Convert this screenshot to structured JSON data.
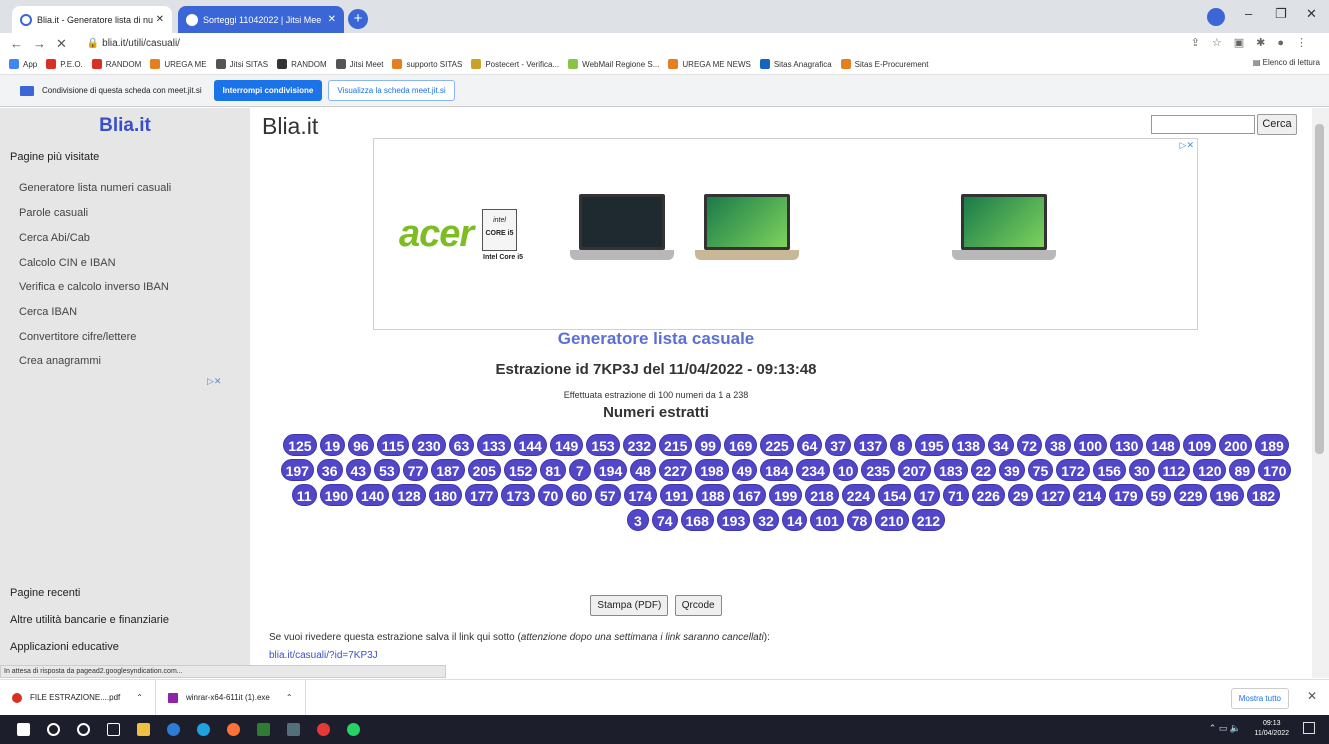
{
  "browser": {
    "tabs": [
      {
        "title": "Blia.it - Generatore lista di nu"
      },
      {
        "title": "Sorteggi 11042022 | Jitsi Mee"
      }
    ],
    "url": "blia.it/utili/casuali/",
    "bookmarks": [
      "App",
      "P.E.O.",
      "RANDOM",
      "UREGA ME",
      "Jitsi SITAS",
      "RANDOM",
      "Jitsi Meet",
      "supporto SITAS",
      "Postecert - Verifica...",
      "WebMail Regione S...",
      "UREGA ME NEWS",
      "Sitas Anagrafica",
      "Sitas E-Procurement"
    ],
    "reading_list": "Elenco di lettura",
    "share_text": "Condivisione di questa scheda con meet.jit.si",
    "stop_share": "Interrompi condivisione",
    "view_tab": "Visualizza la scheda meet.jit.si"
  },
  "sidebar": {
    "logo": "Blia.it",
    "most_visited": "Pagine più visitate",
    "items": [
      "Generatore lista numeri casuali",
      "Parole casuali",
      "Cerca Abi/Cab",
      "Calcolo CIN e IBAN",
      "Verifica e calcolo inverso IBAN",
      "Cerca IBAN",
      "Convertitore cifre/lettere",
      "Crea anagrammi"
    ],
    "recent": "Pagine recenti",
    "bank": "Altre utilità bancarie e finanziarie",
    "edu": "Applicazioni educative"
  },
  "header": {
    "logo": "Blia.it",
    "search_button": "Cerca"
  },
  "ad": {
    "brand": "acer",
    "badge_top": "intel",
    "badge_bottom": "CORE i5",
    "caption": "Intel Core i5"
  },
  "main": {
    "title": "Generatore lista casuale",
    "extraction": "Estrazione id 7KP3J del 11/04/2022 - 09:13:48",
    "info": "Effettuata estrazione di 100 numeri da 1 a 238",
    "drawn_title": "Numeri estratti",
    "numbers": [
      125,
      19,
      96,
      115,
      230,
      63,
      133,
      144,
      149,
      153,
      232,
      215,
      99,
      169,
      225,
      64,
      37,
      137,
      8,
      195,
      138,
      34,
      72,
      38,
      100,
      130,
      148,
      109,
      200,
      189,
      197,
      36,
      43,
      53,
      77,
      187,
      205,
      152,
      81,
      7,
      194,
      48,
      227,
      198,
      49,
      184,
      234,
      10,
      235,
      207,
      183,
      22,
      39,
      75,
      172,
      156,
      30,
      112,
      120,
      89,
      170,
      11,
      190,
      140,
      128,
      180,
      177,
      173,
      70,
      60,
      57,
      174,
      191,
      188,
      167,
      199,
      218,
      224,
      154,
      17,
      71,
      226,
      29,
      127,
      214,
      179,
      59,
      229,
      196,
      182,
      3,
      74,
      168,
      193,
      32,
      14,
      101,
      78,
      210,
      212
    ],
    "print_button": "Stampa (PDF)",
    "qr_button": "Qrcode",
    "save_text_pre": "Se vuoi rivedere questa estrazione salva il link qui sotto (",
    "save_text_em": "attenzione dopo una settimana i link saranno cancellati",
    "save_text_post": "):",
    "save_link": "blia.it/casuali/?id=7KP3J"
  },
  "status": "In attesa di risposta da pagead2.googlesyndication.com...",
  "downloads": {
    "items": [
      "FILE ESTRAZIONE....pdf",
      "winrar-x64-611it (1).exe"
    ],
    "show_all": "Mostra tutto"
  },
  "taskbar": {
    "time": "09:13",
    "date": "11/04/2022"
  },
  "colors": {
    "accent": "#5147c8",
    "brand": "#3b4fc8",
    "tab_active": "#3b66d6"
  }
}
